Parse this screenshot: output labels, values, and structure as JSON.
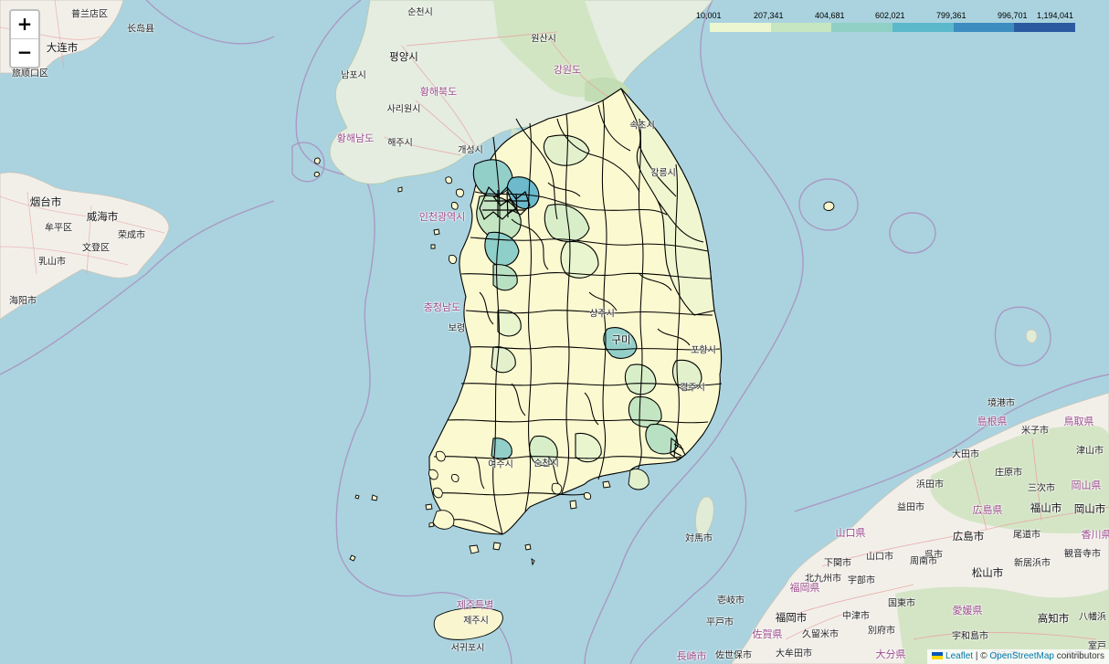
{
  "zoom": {
    "in_label": "+",
    "out_label": "−"
  },
  "legend": {
    "ticks": [
      "10,001",
      "207,341",
      "404,681",
      "602,021",
      "799,361",
      "996,701",
      "1,194,041"
    ],
    "colors": [
      "#ecf7d0",
      "#c5e6c1",
      "#8fd0c4",
      "#5bb8cb",
      "#3d8cc0",
      "#2c5aa0"
    ]
  },
  "attribution": {
    "leaflet": "Leaflet",
    "separator": " | © ",
    "osm": "OpenStreetMap",
    "suffix": " contributors"
  },
  "labels": {
    "cn_putaodian": "普兰店区",
    "cn_changdao": "长岛县",
    "cn_dalian": "大连市",
    "cn_lushunkou": "旅顺口区",
    "cn_yantai": "烟台市",
    "cn_weihai": "威海市",
    "cn_moping": "牟平区",
    "cn_rongcheng": "荣成市",
    "cn_wendeng": "文登区",
    "cn_rushan": "乳山市",
    "cn_haiyang": "海阳市",
    "kp_sunchon": "순천시",
    "kp_wonsan": "원산시",
    "kp_pyongyang": "평양시",
    "kp_nampo": "남포시",
    "kp_kangwon": "강원도",
    "kp_hwangbuk": "황해북도",
    "kp_sariwon": "사리원시",
    "kp_hwangnam": "황해남도",
    "kp_haeju": "해주시",
    "kp_kaesong": "개성시",
    "kr_incheon": "인천광역시",
    "kr_chungnam": "충청남도",
    "kr_boryeong": "보령",
    "kr_jeju": "제주특별",
    "kr_jeju_city": "제주시",
    "kr_seogwipo": "서귀포시",
    "kr_sokcho": "속초시",
    "kr_gangneung": "강릉시",
    "kr_pohang": "포항시",
    "kr_gyeongju": "경주시",
    "kr_sangju": "상주시",
    "kr_gumi": "구미",
    "kr_suncheon": "순천시",
    "kr_yeosu": "여수시",
    "jp_tsushima": "対馬市",
    "jp_oki": "境港市",
    "jp_shimane": "島根県",
    "jp_yonago": "米子市",
    "jp_tottori": "鳥取県",
    "jp_daisen": "大田市",
    "jp_tsuyama": "津山市",
    "jp_shobara": "庄原市",
    "jp_hamada": "浜田市",
    "jp_miyoshi": "三次市",
    "jp_okayama_pref": "岡山県",
    "jp_masuda": "益田市",
    "jp_hiroshima_pref": "広島県",
    "jp_fukuyama": "福山市",
    "jp_okayama": "岡山市",
    "jp_onomichi": "尾道市",
    "jp_kagawa": "香川県",
    "jp_yamaguchi_pref": "山口県",
    "jp_hiroshima": "広島市",
    "jp_kure": "呉市",
    "jp_niihama": "新居浜市",
    "jp_kannonji": "観音寺市",
    "jp_shimonoseki": "下関市",
    "jp_yamaguchi": "山口市",
    "jp_shunan": "周南市",
    "jp_matsuyama": "松山市",
    "jp_fukuoka_pref": "福岡県",
    "jp_ube": "宇部市",
    "jp_iki": "壱岐市",
    "jp_fukuoka": "福岡市",
    "jp_kunisaki": "国東市",
    "jp_ehime": "愛媛県",
    "jp_kochi": "高知市",
    "jp_nakatsu": "中津市",
    "jp_beppu": "別府市",
    "jp_hirado": "平戸市",
    "jp_saga": "佐賀県",
    "jp_kurume": "久留米市",
    "jp_uwajima": "宇和島市",
    "jp_nagasaki": "長崎市",
    "jp_sasebo": "佐世保市",
    "jp_omuta": "大牟田市",
    "jp_oita": "大分県",
    "jp_sukumo": "宿毛市",
    "jp_kitakyushu": "北九州市",
    "jp_muroto": "室戸",
    "jp_kochi_pref": "高知",
    "jp_yawatahama": "八幡浜"
  }
}
